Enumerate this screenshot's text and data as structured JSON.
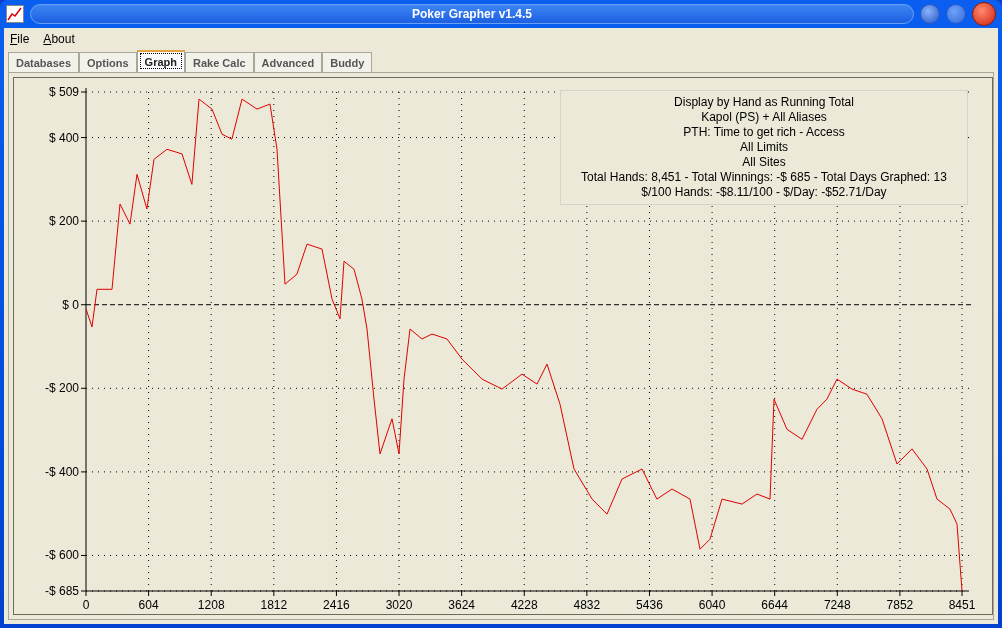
{
  "window": {
    "title": "Poker Grapher v1.4.5"
  },
  "menu": [
    "File",
    "About"
  ],
  "tabs": [
    {
      "label": "Databases",
      "selected": false
    },
    {
      "label": "Options",
      "selected": false
    },
    {
      "label": "Graph",
      "selected": true
    },
    {
      "label": "Rake Calc",
      "selected": false
    },
    {
      "label": "Advanced",
      "selected": false
    },
    {
      "label": "Buddy",
      "selected": false
    }
  ],
  "graph": {
    "info_lines": [
      "Display by Hand as Running Total",
      "Kapol (PS) + All Aliases",
      "PTH: Time to get rich - Access",
      "All Limits",
      "All Sites",
      "Total Hands: 8,451 - Total Winnings: -$ 685 - Total Days Graphed: 13",
      "$/100 Hands: -$8.11/100 - $/Day: -$52.71/Day"
    ],
    "chart_data": {
      "type": "line",
      "grid": true,
      "xlim": [
        0,
        8451
      ],
      "ylim": [
        -685,
        509
      ],
      "xticks": [
        0,
        604,
        1208,
        1812,
        2416,
        3020,
        3624,
        4228,
        4832,
        5436,
        6040,
        6644,
        7248,
        7852,
        8451
      ],
      "yticks": [
        {
          "value": 509,
          "label": "$ 509"
        },
        {
          "value": 400,
          "label": "$ 400"
        },
        {
          "value": 200,
          "label": "$ 200"
        },
        {
          "value": 0,
          "label": "$ 0"
        },
        {
          "value": -200,
          "label": "-$ 200"
        },
        {
          "value": -400,
          "label": "-$ 400"
        },
        {
          "value": -600,
          "label": "-$ 600"
        },
        {
          "value": -685,
          "label": "-$ 685"
        }
      ],
      "x": [
        0,
        58,
        106,
        251,
        328,
        424,
        492,
        588,
        656,
        781,
        926,
        1022,
        1090,
        1216,
        1312,
        1408,
        1505,
        1650,
        1775,
        1843,
        1920,
        2035,
        2132,
        2277,
        2373,
        2450,
        2489,
        2585,
        2662,
        2711,
        2778,
        2836,
        2952,
        3020,
        3068,
        3126,
        3241,
        3338,
        3483,
        3627,
        3820,
        4013,
        4206,
        4351,
        4447,
        4573,
        4708,
        4882,
        5026,
        5171,
        5364,
        5508,
        5653,
        5827,
        5923,
        6020,
        6136,
        6329,
        6473,
        6599,
        6637,
        6763,
        6907,
        7052,
        7148,
        7245,
        7390,
        7534,
        7679,
        7824,
        7969,
        8113,
        8210,
        8335,
        8403,
        8451
      ],
      "series": [
        {
          "color": "#e00000",
          "values": [
            -10,
            -53,
            37,
            37,
            241,
            193,
            312,
            229,
            348,
            372,
            361,
            288,
            492,
            468,
            408,
            396,
            492,
            468,
            480,
            372,
            49,
            73,
            145,
            133,
            14,
            -34,
            104,
            85,
            14,
            -58,
            -226,
            -357,
            -273,
            -357,
            -178,
            -58,
            -82,
            -70,
            -82,
            -130,
            -178,
            -202,
            -166,
            -190,
            -142,
            -238,
            -393,
            -465,
            -501,
            -417,
            -393,
            -465,
            -441,
            -465,
            -585,
            -561,
            -465,
            -477,
            -453,
            -465,
            -226,
            -298,
            -322,
            -250,
            -226,
            -178,
            -202,
            -214,
            -273,
            -381,
            -345,
            -393,
            -465,
            -489,
            -525,
            -685
          ]
        }
      ]
    }
  }
}
